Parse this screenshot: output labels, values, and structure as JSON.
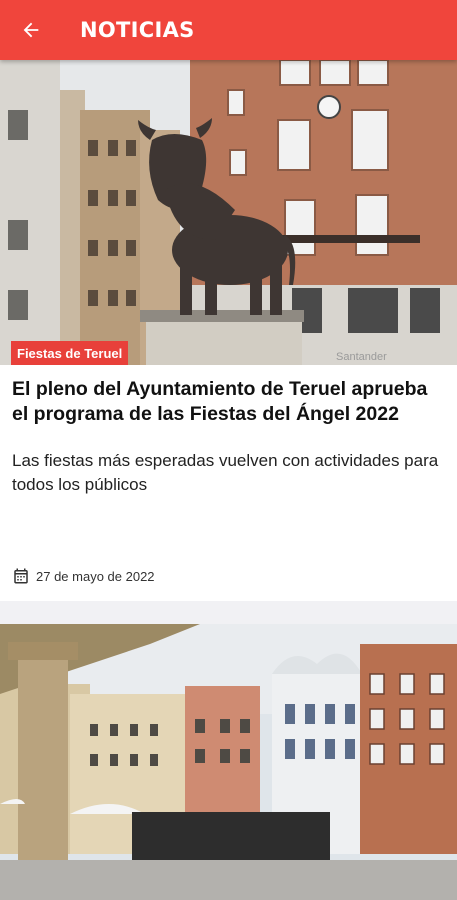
{
  "appbar": {
    "title": "NOTICIAS",
    "back_icon": "arrow-left-icon"
  },
  "articles": [
    {
      "category": "Fiestas de Teruel",
      "headline": "El pleno del Ayuntamiento de Teruel aprueba el programa de las Fiestas del Ángel 2022",
      "summary": "Las fiestas más esperadas vuelven con actividades para todos los públicos",
      "date": "27 de mayo de 2022",
      "date_icon": "calendar-icon"
    }
  ],
  "colors": {
    "accent": "#f0453c",
    "tag": "#e8403a"
  }
}
